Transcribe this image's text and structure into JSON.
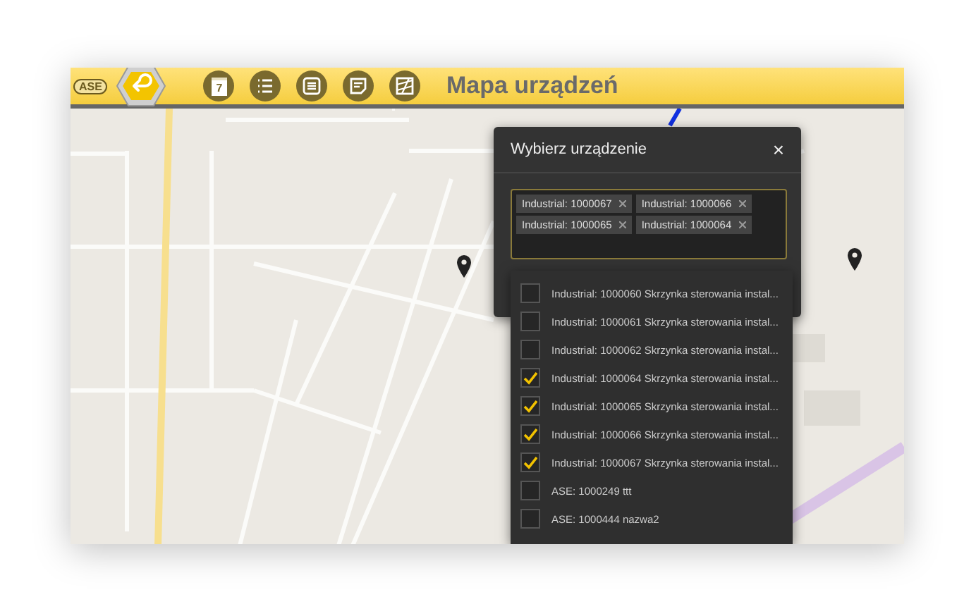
{
  "toolbar": {
    "logo": "ASE",
    "title": "Mapa urządzeń",
    "buttons": [
      {
        "kind": "calendar",
        "day": "7"
      },
      {
        "kind": "list"
      },
      {
        "kind": "menu"
      },
      {
        "kind": "note"
      },
      {
        "kind": "map"
      }
    ]
  },
  "dialog": {
    "title": "Wybierz urządzenie",
    "close": "×",
    "tags": [
      {
        "label": "Industrial: 1000067"
      },
      {
        "label": "Industrial: 1000066"
      },
      {
        "label": "Industrial: 1000065"
      },
      {
        "label": "Industrial: 1000064"
      }
    ],
    "options": [
      {
        "label": "Industrial: 1000060 Skrzynka sterowania instal...",
        "checked": false
      },
      {
        "label": "Industrial: 1000061 Skrzynka sterowania instal...",
        "checked": false
      },
      {
        "label": "Industrial: 1000062 Skrzynka sterowania instal...",
        "checked": false
      },
      {
        "label": "Industrial: 1000064 Skrzynka sterowania instal...",
        "checked": true
      },
      {
        "label": "Industrial: 1000065 Skrzynka sterowania instal...",
        "checked": true
      },
      {
        "label": "Industrial: 1000066 Skrzynka sterowania instal...",
        "checked": true
      },
      {
        "label": "Industrial: 1000067 Skrzynka sterowania instal...",
        "checked": true
      },
      {
        "label": "ASE: 1000249 ttt",
        "checked": false
      },
      {
        "label": "ASE: 1000444 nazwa2",
        "checked": false
      }
    ]
  }
}
